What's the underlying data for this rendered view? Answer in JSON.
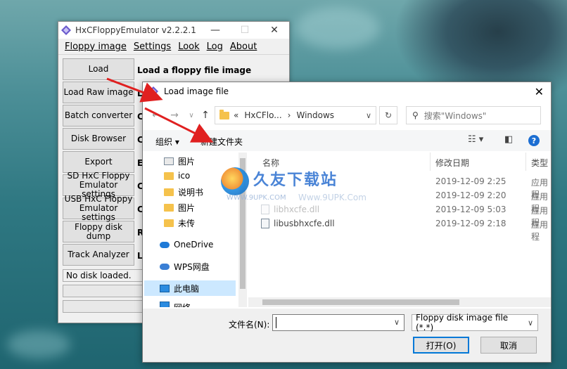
{
  "colors": {
    "accent": "#0078d7",
    "arrow": "#e02020",
    "folder": "#f5c24c",
    "nav_selection": "#cce8ff"
  },
  "hxc_window": {
    "title": "HxCFloppyEmulator v2.2.2.1",
    "menu": [
      "Floppy image",
      "Settings",
      "Look",
      "Log",
      "About"
    ],
    "buttons": [
      "Load",
      "Load Raw image",
      "Batch converter",
      "Disk Browser",
      "Export",
      "SD HxC Floppy Emulator settings",
      "USB HxC Floppy Emulator settings",
      "Floppy disk dump",
      "Track Analyzer"
    ],
    "descriptions": [
      "Load a floppy file image",
      "L",
      "C",
      "C",
      "E",
      "C",
      "C",
      "R",
      "L"
    ],
    "status": "No disk loaded."
  },
  "dialog": {
    "title": "Load image file",
    "address": [
      "«",
      "HxCFlo...",
      "›",
      "Windows"
    ],
    "search_placeholder": "搜索\"Windows\"",
    "toolbar": {
      "organize": "组织 ▾",
      "new_folder": "新建文件夹"
    },
    "nav_items": [
      {
        "label": "图片",
        "icon": "pictures-icon"
      },
      {
        "label": "ico",
        "icon": "folder-icon"
      },
      {
        "label": "说明书",
        "icon": "folder-icon"
      },
      {
        "label": "图片",
        "icon": "folder-icon"
      },
      {
        "label": "未传",
        "icon": "folder-icon"
      },
      {
        "label": "OneDrive",
        "icon": "onedrive-icon"
      },
      {
        "label": "WPS网盘",
        "icon": "wps-cloud-icon"
      },
      {
        "label": "此电脑",
        "icon": "pc-icon"
      },
      {
        "label": "网络",
        "icon": "network-icon"
      }
    ],
    "columns": {
      "name": "名称",
      "date": "修改日期",
      "type": "类型"
    },
    "files": [
      {
        "name": "",
        "date": "2019-12-09 2:25",
        "type": "应用程"
      },
      {
        "name": "",
        "date": "2019-12-09 2:20",
        "type": "应用程"
      },
      {
        "name": "libhxcfe.dll",
        "date": "2019-12-09 5:03",
        "type": "应用程"
      },
      {
        "name": "libusbhxcfe.dll",
        "date": "2019-12-09 2:18",
        "type": "应用程"
      }
    ],
    "filename_label": "文件名(N):",
    "filename_value": "",
    "file_type": "Floppy disk image file (*.*)",
    "open_button": "打开(O)",
    "cancel_button": "取消"
  },
  "watermark": {
    "brand": "久友下载站",
    "url": "WWW.9UPK.COM",
    "url2": "Www.9UPK.Com"
  }
}
